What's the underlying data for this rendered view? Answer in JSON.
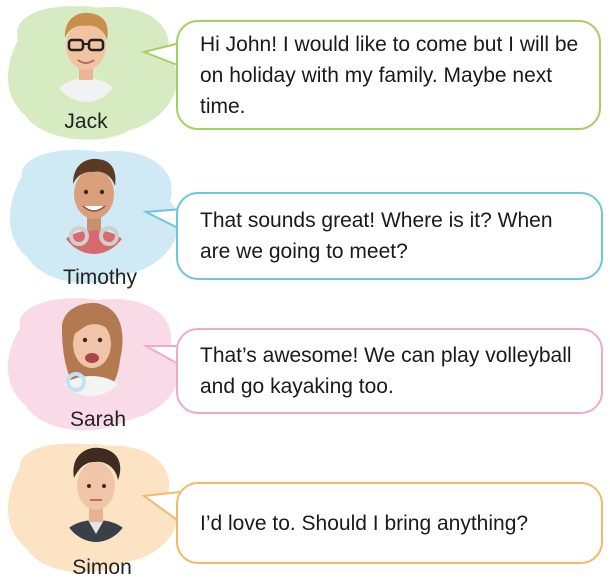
{
  "messages": [
    {
      "name": "Jack",
      "text": "Hi John! I would like to come but I will be on holiday with my family. Maybe next time.",
      "color": "#a6cf62",
      "splash": "#d7ebc3"
    },
    {
      "name": "Timothy",
      "text": "That sounds great! Where is it? When are we going to meet?",
      "color": "#6fc5dc",
      "splash": "#cfe9f5"
    },
    {
      "name": "Sarah",
      "text": "That’s awesome! We can play volleyball and go kayaking too.",
      "color": "#f0aac4",
      "splash": "#f9dbe7"
    },
    {
      "name": "Simon",
      "text": "I’d love to. Should I bring anything?",
      "color": "#f3b86a",
      "splash": "#fbe3c4"
    }
  ]
}
